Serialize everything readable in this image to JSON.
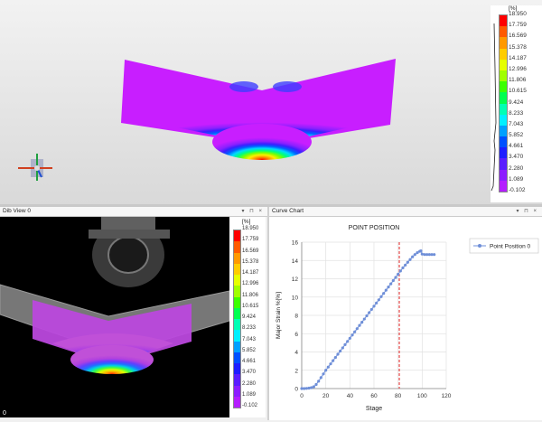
{
  "top_legend": {
    "unit": "[%]",
    "values": [
      "18.950",
      "17.759",
      "16.569",
      "15.378",
      "14.187",
      "12.996",
      "11.806",
      "10.615",
      "9.424",
      "8.233",
      "7.043",
      "5.852",
      "4.661",
      "3.470",
      "2.280",
      "1.089",
      "-0.102"
    ],
    "colors": [
      "#ff0000",
      "#ff5a00",
      "#ff9900",
      "#ffcc00",
      "#e6ff00",
      "#a0ff00",
      "#3cff00",
      "#00ff50",
      "#00ffb4",
      "#00f0ff",
      "#00a0ff",
      "#0050ff",
      "#1e1eff",
      "#5a1eff",
      "#8c1eff",
      "#b41eff",
      "#d21eff"
    ]
  },
  "dic_panel": {
    "title": "Dib View 0",
    "frame_number": "0",
    "legend_unit": "[%]",
    "legend_values": [
      "18.950",
      "17.759",
      "16.569",
      "15.378",
      "14.187",
      "12.996",
      "11.806",
      "10.615",
      "9.424",
      "8.233",
      "7.043",
      "5.852",
      "4.661",
      "3.470",
      "2.280",
      "1.089",
      "-0.102"
    ]
  },
  "chart_panel": {
    "title": "Curve Chart"
  },
  "chart_data": {
    "type": "line",
    "title": "POINT POSITION",
    "xlabel": "Stage",
    "ylabel": "Major Strain %[%]",
    "xlim": [
      0,
      120
    ],
    "ylim": [
      0,
      16
    ],
    "xticks": [
      0,
      20,
      40,
      60,
      80,
      100,
      120
    ],
    "yticks": [
      0,
      2,
      4,
      6,
      8,
      10,
      12,
      14,
      16
    ],
    "marker_line_x": 81,
    "series": [
      {
        "name": "Point Position 0",
        "color": "#6f8fd8",
        "x": [
          0,
          2,
          4,
          6,
          8,
          10,
          12,
          14,
          16,
          18,
          20,
          22,
          24,
          26,
          28,
          30,
          32,
          34,
          36,
          38,
          40,
          42,
          44,
          46,
          48,
          50,
          52,
          54,
          56,
          58,
          60,
          62,
          64,
          66,
          68,
          70,
          72,
          74,
          76,
          78,
          80,
          82,
          84,
          86,
          88,
          90,
          92,
          94,
          96,
          98,
          99,
          100,
          102,
          104,
          106,
          108,
          110
        ],
        "y": [
          0.0,
          0.0,
          0.02,
          0.05,
          0.1,
          0.2,
          0.45,
          0.8,
          1.2,
          1.6,
          2.0,
          2.35,
          2.7,
          3.05,
          3.4,
          3.75,
          4.1,
          4.45,
          4.8,
          5.15,
          5.5,
          5.85,
          6.2,
          6.55,
          6.9,
          7.25,
          7.6,
          7.95,
          8.3,
          8.65,
          9.0,
          9.35,
          9.7,
          10.05,
          10.4,
          10.75,
          11.1,
          11.45,
          11.8,
          12.15,
          12.5,
          12.85,
          13.2,
          13.5,
          13.8,
          14.1,
          14.4,
          14.65,
          14.85,
          15.0,
          15.05,
          14.7,
          14.65,
          14.65,
          14.65,
          14.65,
          14.65
        ]
      }
    ]
  }
}
